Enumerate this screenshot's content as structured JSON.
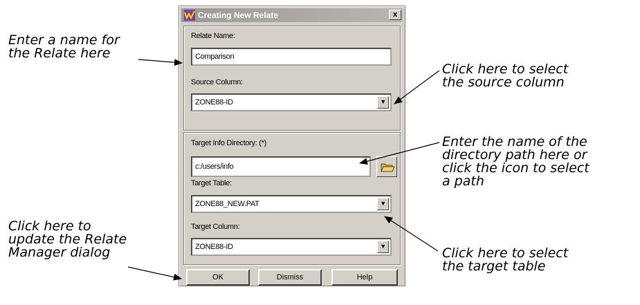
{
  "window": {
    "title": "Creating New Relate",
    "close_label": "x"
  },
  "relate_name": {
    "label": "Relate Name:",
    "value": "Comparison"
  },
  "source_column": {
    "label": "Source Column:",
    "value": "ZONE88-ID",
    "arrow": "▼"
  },
  "target_info_dir": {
    "label": "Target Info Directory: (*)",
    "value": "c:/users/info"
  },
  "target_table": {
    "label": "Target Table:",
    "value": "ZONE88_NEW.PAT",
    "arrow": "▼"
  },
  "target_column": {
    "label": "Target Column:",
    "value": "ZONE88-ID",
    "arrow": "▼"
  },
  "buttons": {
    "ok": "OK",
    "dismiss": "Dismiss",
    "help": "Help"
  },
  "callouts": {
    "relate_name": "Enter a name for\nthe Relate here",
    "source_column": "Click here to select\nthe source column",
    "directory": "Enter the name of the\ndirectory path here or\nclick the icon to select\na path",
    "update": "Click here to\nupdate the Relate\nManager dialog",
    "target_table": "Click here to select\nthe target table"
  },
  "icons": [
    "app-icon",
    "close-icon",
    "dropdown-arrow-icon",
    "folder-icon"
  ]
}
